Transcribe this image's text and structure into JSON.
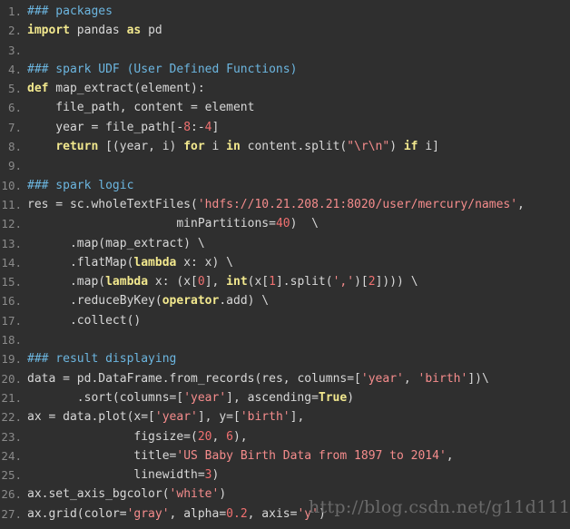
{
  "editor": {
    "background_color": "#2f2f2f",
    "default_text_color": "#d8d8d8",
    "gutter_color": "#8a8a8a",
    "language": "python",
    "first_line_number": 1,
    "last_line_number": 27,
    "total_lines_visible": 27
  },
  "theme_colors": {
    "comment": "#6cb6e0",
    "keyword": "#f2e88e",
    "builtin": "#f2e88e",
    "string": "#f58c8c",
    "number": "#f07070",
    "class_name": "#7fcf7f",
    "plain": "#d8d8d8"
  },
  "watermark": {
    "text": "http://blog.csdn.net/g11d111",
    "color": "#6a6a6a"
  },
  "lines": [
    {
      "number": "1.",
      "tokens": [
        {
          "t": "### packages",
          "c": "comment"
        }
      ]
    },
    {
      "number": "2.",
      "tokens": [
        {
          "t": "import",
          "c": "keyword"
        },
        {
          "t": " pandas ",
          "c": "plain"
        },
        {
          "t": "as",
          "c": "keyword"
        },
        {
          "t": " pd",
          "c": "plain"
        }
      ]
    },
    {
      "number": "3.",
      "tokens": []
    },
    {
      "number": "4.",
      "tokens": [
        {
          "t": "### spark UDF (User Defined Functions)",
          "c": "comment"
        }
      ]
    },
    {
      "number": "5.",
      "tokens": [
        {
          "t": "def",
          "c": "keyword"
        },
        {
          "t": " map_extract(element):",
          "c": "plain"
        }
      ]
    },
    {
      "number": "6.",
      "tokens": [
        {
          "t": "    file_path, content = element",
          "c": "plain"
        }
      ]
    },
    {
      "number": "7.",
      "tokens": [
        {
          "t": "    year = file_path[-",
          "c": "plain"
        },
        {
          "t": "8",
          "c": "number"
        },
        {
          "t": ":-",
          "c": "plain"
        },
        {
          "t": "4",
          "c": "number"
        },
        {
          "t": "]",
          "c": "plain"
        }
      ]
    },
    {
      "number": "8.",
      "tokens": [
        {
          "t": "    ",
          "c": "plain"
        },
        {
          "t": "return",
          "c": "keyword"
        },
        {
          "t": " [(year, i) ",
          "c": "plain"
        },
        {
          "t": "for",
          "c": "keyword"
        },
        {
          "t": " i ",
          "c": "plain"
        },
        {
          "t": "in",
          "c": "keyword"
        },
        {
          "t": " content.split(",
          "c": "plain"
        },
        {
          "t": "\"\\r\\n\"",
          "c": "string"
        },
        {
          "t": ") ",
          "c": "plain"
        },
        {
          "t": "if",
          "c": "keyword"
        },
        {
          "t": " i]",
          "c": "plain"
        }
      ]
    },
    {
      "number": "9.",
      "tokens": []
    },
    {
      "number": "10.",
      "tokens": [
        {
          "t": "### spark logic",
          "c": "comment"
        }
      ]
    },
    {
      "number": "11.",
      "tokens": [
        {
          "t": "res = sc.wholeTextFiles(",
          "c": "plain"
        },
        {
          "t": "'hdfs://10.21.208.21:8020/user/mercury/names'",
          "c": "string"
        },
        {
          "t": ",",
          "c": "plain"
        }
      ]
    },
    {
      "number": "12.",
      "tokens": [
        {
          "t": "                     minPartitions=",
          "c": "plain"
        },
        {
          "t": "40",
          "c": "number"
        },
        {
          "t": ")  \\",
          "c": "plain"
        }
      ]
    },
    {
      "number": "13.",
      "tokens": [
        {
          "t": "      .map(map_extract) \\",
          "c": "plain"
        }
      ]
    },
    {
      "number": "14.",
      "tokens": [
        {
          "t": "      .flatMap(",
          "c": "plain"
        },
        {
          "t": "lambda",
          "c": "keyword"
        },
        {
          "t": " x: x) \\",
          "c": "plain"
        }
      ]
    },
    {
      "number": "15.",
      "tokens": [
        {
          "t": "      .map(",
          "c": "plain"
        },
        {
          "t": "lambda",
          "c": "keyword"
        },
        {
          "t": " x: (x[",
          "c": "plain"
        },
        {
          "t": "0",
          "c": "number"
        },
        {
          "t": "], ",
          "c": "plain"
        },
        {
          "t": "int",
          "c": "builtin"
        },
        {
          "t": "(x[",
          "c": "plain"
        },
        {
          "t": "1",
          "c": "number"
        },
        {
          "t": "].split(",
          "c": "plain"
        },
        {
          "t": "','",
          "c": "string"
        },
        {
          "t": ")[",
          "c": "plain"
        },
        {
          "t": "2",
          "c": "number"
        },
        {
          "t": "]))) \\",
          "c": "plain"
        }
      ]
    },
    {
      "number": "16.",
      "tokens": [
        {
          "t": "      .reduceByKey(",
          "c": "plain"
        },
        {
          "t": "operator",
          "c": "builtin"
        },
        {
          "t": ".add) \\",
          "c": "plain"
        }
      ]
    },
    {
      "number": "17.",
      "tokens": [
        {
          "t": "      .collect()",
          "c": "plain"
        }
      ]
    },
    {
      "number": "18.",
      "tokens": []
    },
    {
      "number": "19.",
      "tokens": [
        {
          "t": "### result displaying",
          "c": "comment"
        }
      ]
    },
    {
      "number": "20.",
      "tokens": [
        {
          "t": "data = pd.",
          "c": "plain"
        },
        {
          "t": "DataFrame",
          "c": "class_name"
        },
        {
          "t": ".from_records(res, columns=[",
          "c": "plain"
        },
        {
          "t": "'year'",
          "c": "string"
        },
        {
          "t": ", ",
          "c": "plain"
        },
        {
          "t": "'birth'",
          "c": "string"
        },
        {
          "t": "])\\",
          "c": "plain"
        }
      ]
    },
    {
      "number": "21.",
      "tokens": [
        {
          "t": "       .sort(columns=[",
          "c": "plain"
        },
        {
          "t": "'year'",
          "c": "string"
        },
        {
          "t": "], ascending=",
          "c": "plain"
        },
        {
          "t": "True",
          "c": "keyword"
        },
        {
          "t": ")",
          "c": "plain"
        }
      ]
    },
    {
      "number": "22.",
      "tokens": [
        {
          "t": "ax = data.plot(x=[",
          "c": "plain"
        },
        {
          "t": "'year'",
          "c": "string"
        },
        {
          "t": "], y=[",
          "c": "plain"
        },
        {
          "t": "'birth'",
          "c": "string"
        },
        {
          "t": "],",
          "c": "plain"
        }
      ]
    },
    {
      "number": "23.",
      "tokens": [
        {
          "t": "               figsize=(",
          "c": "plain"
        },
        {
          "t": "20",
          "c": "number"
        },
        {
          "t": ", ",
          "c": "plain"
        },
        {
          "t": "6",
          "c": "number"
        },
        {
          "t": "),",
          "c": "plain"
        }
      ]
    },
    {
      "number": "24.",
      "tokens": [
        {
          "t": "               title=",
          "c": "plain"
        },
        {
          "t": "'US Baby Birth Data from 1897 to 2014'",
          "c": "string"
        },
        {
          "t": ",",
          "c": "plain"
        }
      ]
    },
    {
      "number": "25.",
      "tokens": [
        {
          "t": "               linewidth=",
          "c": "plain"
        },
        {
          "t": "3",
          "c": "number"
        },
        {
          "t": ")",
          "c": "plain"
        }
      ]
    },
    {
      "number": "26.",
      "tokens": [
        {
          "t": "ax.set_axis_bgcolor(",
          "c": "plain"
        },
        {
          "t": "'white'",
          "c": "string"
        },
        {
          "t": ")",
          "c": "plain"
        }
      ]
    },
    {
      "number": "27.",
      "tokens": [
        {
          "t": "ax.grid(color=",
          "c": "plain"
        },
        {
          "t": "'gray'",
          "c": "string"
        },
        {
          "t": ", alpha=",
          "c": "plain"
        },
        {
          "t": "0.2",
          "c": "number"
        },
        {
          "t": ", axis=",
          "c": "plain"
        },
        {
          "t": "'y'",
          "c": "string"
        },
        {
          "t": ")",
          "c": "plain"
        }
      ]
    }
  ]
}
